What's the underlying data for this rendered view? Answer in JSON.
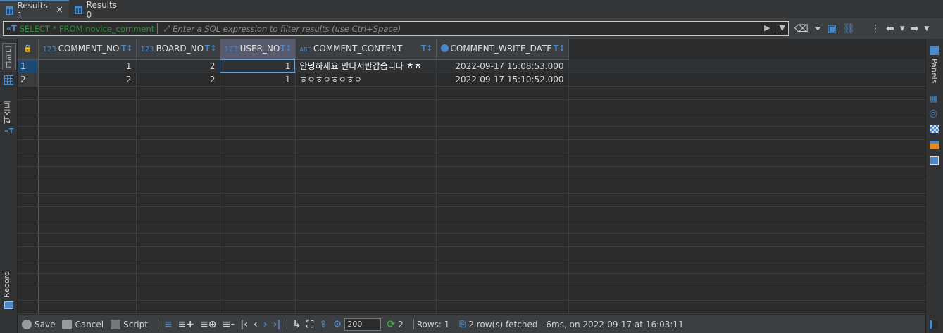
{
  "tabs": [
    {
      "label": "Results 1",
      "active": true
    },
    {
      "label": "Results 0",
      "active": false
    }
  ],
  "filter": {
    "sql": "SELECT * FROM novice_comment",
    "placeholder": "Enter a SQL expression to filter results (use Ctrl+Space)"
  },
  "left_panel": {
    "grid_label": "그리드",
    "text_label": "텍스트",
    "record_label": "Record"
  },
  "right_panel": {
    "panels_label": "Panels"
  },
  "columns": [
    {
      "type": "123",
      "name": "COMMENT_NO"
    },
    {
      "type": "123",
      "name": "BOARD_NO"
    },
    {
      "type": "123",
      "name": "USER_NO"
    },
    {
      "type": "ABC",
      "name": "COMMENT_CONTENT"
    },
    {
      "type": "clock",
      "name": "COMMENT_WRITE_DATE"
    }
  ],
  "rows": [
    {
      "n": "1",
      "cells": [
        "1",
        "2",
        "1",
        "안녕하세요 만나서반갑습니다 ㅎㅎ",
        "2022-09-17 15:08:53.000"
      ]
    },
    {
      "n": "2",
      "cells": [
        "2",
        "2",
        "1",
        "ㅎㅇㅎㅇㅎㅇㅎㅇ",
        "2022-09-17 15:10:52.000"
      ]
    }
  ],
  "bottom": {
    "save": "Save",
    "cancel": "Cancel",
    "script": "Script",
    "fetch_size": "200",
    "refresh_count": "2",
    "rows_label": "Rows: 1",
    "status": "2 row(s) fetched - 6ms, on 2022-09-17 at 16:03:11"
  },
  "colors": {
    "accent": "#4a88c7",
    "selected": "#1d4a73",
    "sql_text": "#2f8f3e"
  }
}
